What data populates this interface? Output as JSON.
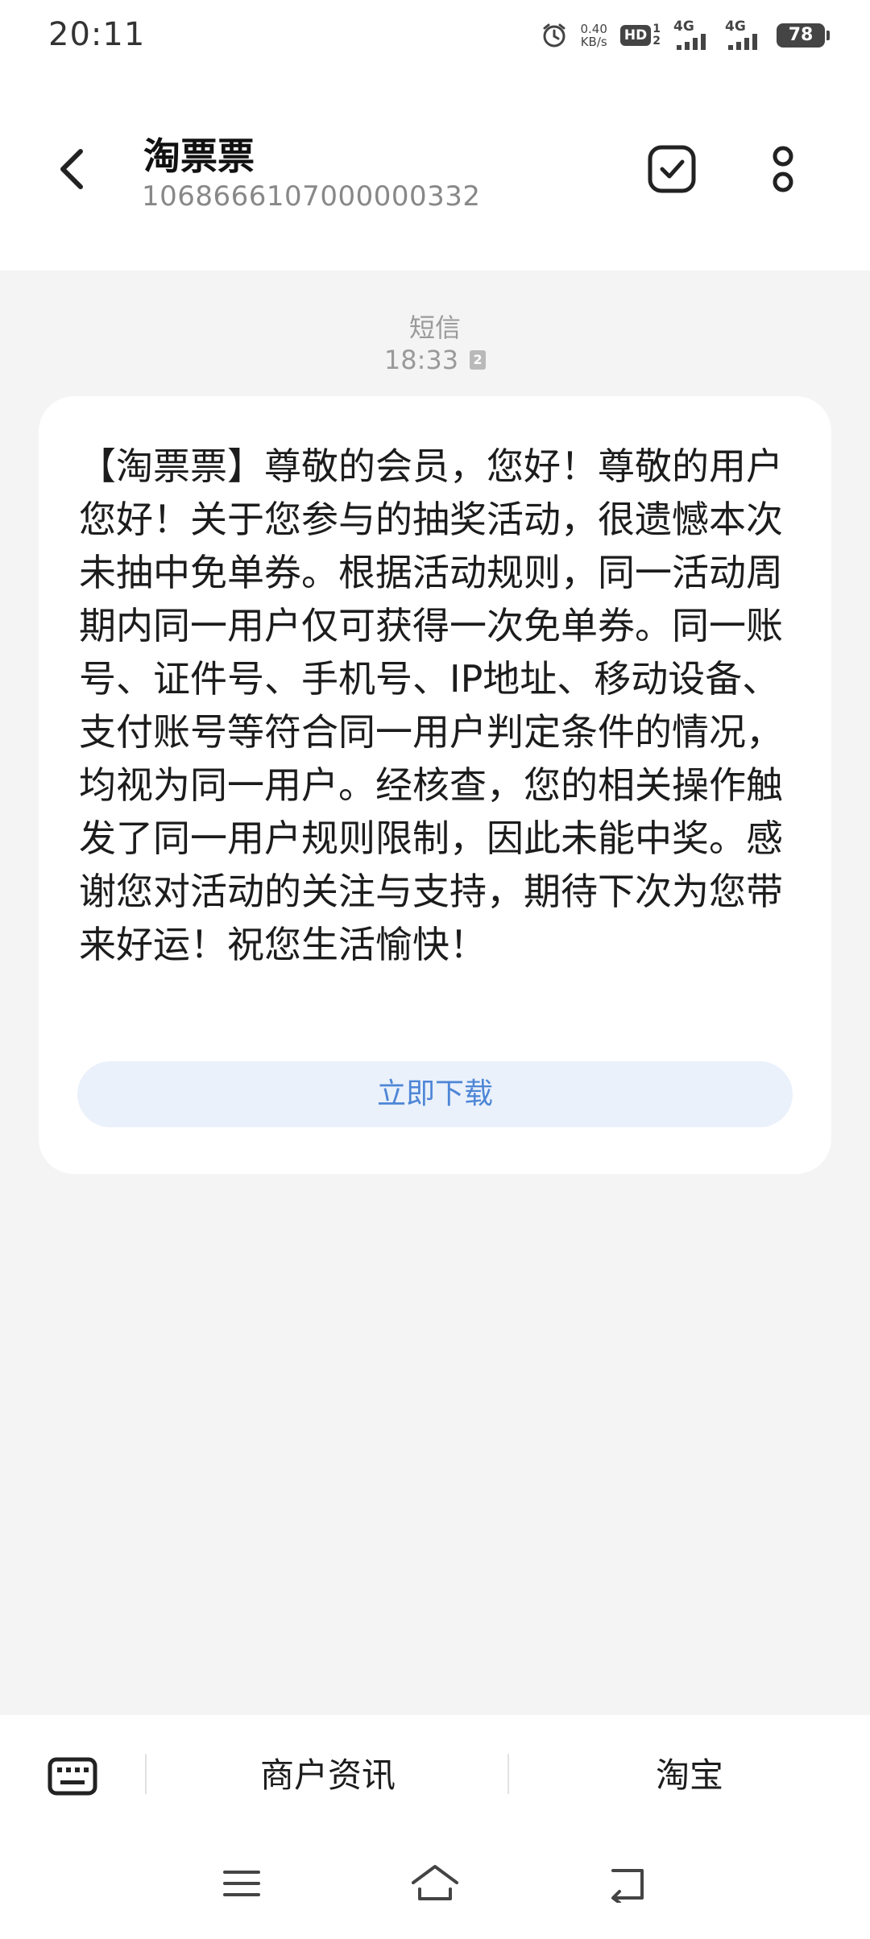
{
  "status_bar": {
    "time": "20:11",
    "net_speed_value": "0.40",
    "net_speed_unit": "KB/s",
    "hd_label": "HD",
    "hd_sim_top": "1",
    "hd_sim_bottom": "2",
    "signal1_label": "4G",
    "signal2_label": "4G",
    "battery_level": "78"
  },
  "header": {
    "contact_name": "淘票票",
    "contact_number": "1068666107000000332"
  },
  "conversation": {
    "message_type": "短信",
    "message_time": "18:33",
    "sim_slot": "2",
    "message_body": "【淘票票】尊敬的会员，您好！尊敬的用户您好！关于您参与的抽奖活动，很遗憾本次未抽中免单券。根据活动规则，同一活动周期内同一用户仅可获得一次免单券。同一账号、证件号、手机号、IP地址、移动设备、支付账号等符合同一用户判定条件的情况，均视为同一用户。经核查，您的相关操作触发了同一用户规则限制，因此未能中奖。感谢您对活动的关注与支持，期待下次为您带来好运！祝您生活愉快！",
    "download_label": "立即下载"
  },
  "bottom_menu": {
    "items": [
      "商户资讯",
      "淘宝"
    ]
  },
  "icons": {
    "back": "chevron-left-icon",
    "select": "checkbox-icon",
    "more": "more-vertical-icon",
    "keyboard": "keyboard-icon",
    "nav_menu": "menu-icon",
    "nav_home": "home-icon",
    "nav_back": "back-icon",
    "alarm": "alarm-icon"
  },
  "colors": {
    "link_blue": "#4e86d6",
    "button_bg": "#eaf1fb",
    "page_bg": "#f4f4f4"
  }
}
